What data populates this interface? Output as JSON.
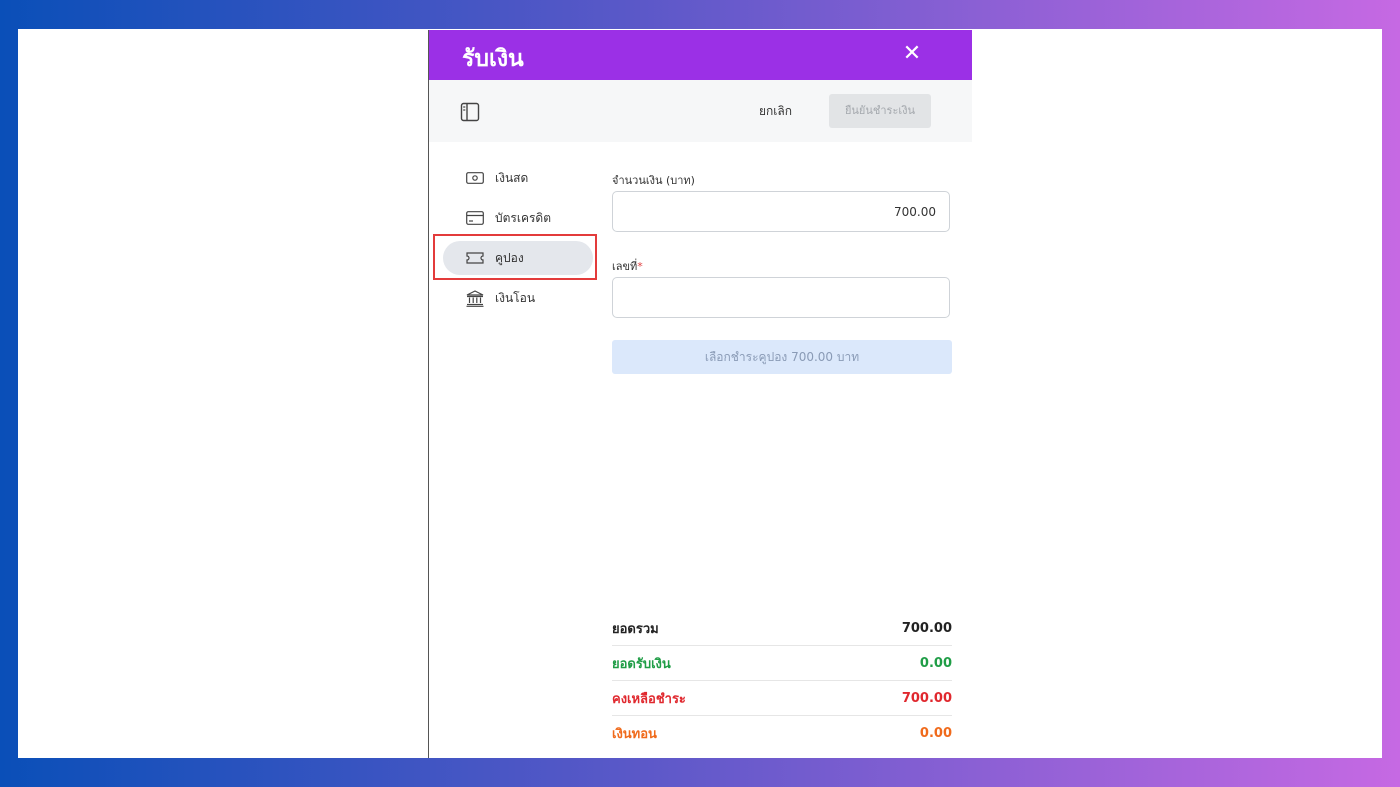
{
  "modal": {
    "title": "รับเงิน",
    "close_icon": "close-icon"
  },
  "toolbar": {
    "panel_icon": "panel-toggle-icon",
    "cancel_label": "ยกเลิก",
    "confirm_label": "ยืนยันชำระเงิน"
  },
  "sidebar": {
    "items": [
      {
        "label": "เงินสด",
        "icon": "cash-icon",
        "active": false
      },
      {
        "label": "บัตรเครดิต",
        "icon": "credit-card-icon",
        "active": false
      },
      {
        "label": "คูปอง",
        "icon": "coupon-icon",
        "active": true
      },
      {
        "label": "เงินโอน",
        "icon": "bank-icon",
        "active": false
      }
    ]
  },
  "form": {
    "amount_label": "จำนวนเงิน (บาท)",
    "amount_value": "700.00",
    "number_label": "เลขที่",
    "required_mark": "*",
    "number_value": "",
    "submit_label": "เลือกชำระคูปอง 700.00 บาท"
  },
  "summary": {
    "rows": [
      {
        "label": "ยอดรวม",
        "value": "700.00",
        "color": "#222222"
      },
      {
        "label": "ยอดรับเงิน",
        "value": "0.00",
        "color": "#1f9d46"
      },
      {
        "label": "คงเหลือชำระ",
        "value": "700.00",
        "color": "#e0282e"
      },
      {
        "label": "เงินทอน",
        "value": "0.00",
        "color": "#f06a1b"
      }
    ]
  },
  "colors": {
    "header": "#9b30e6",
    "highlight": "#e33b3b"
  }
}
